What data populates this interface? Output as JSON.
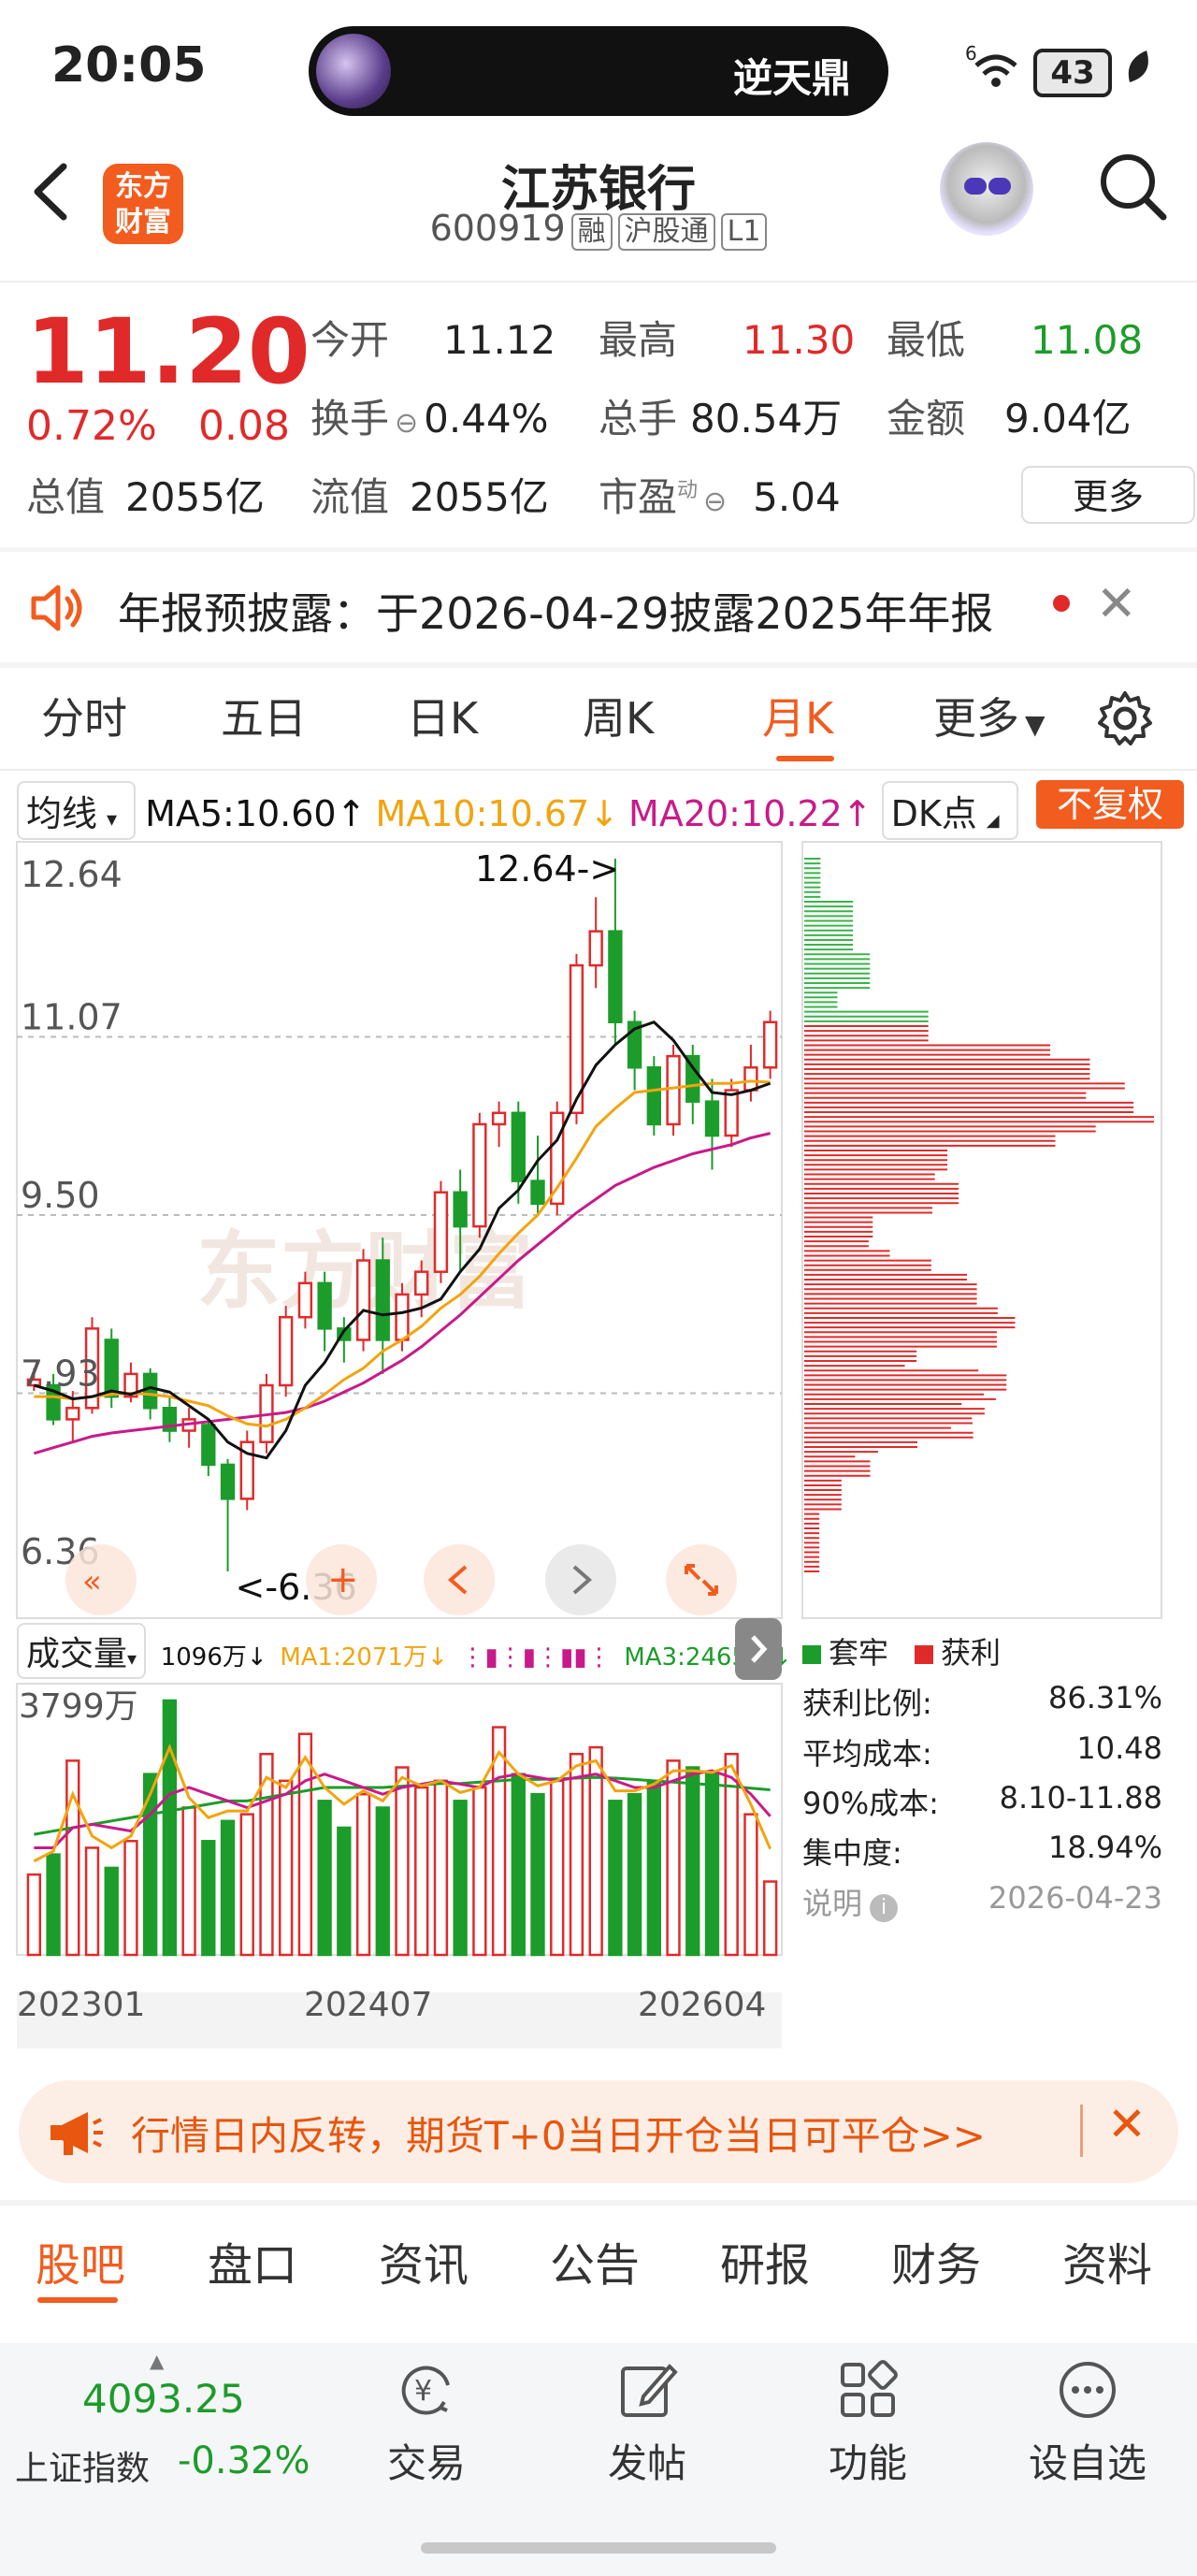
{
  "status_bar": {
    "time": "20:05",
    "island_title": "逆天鼎",
    "signal": "6",
    "battery": "43"
  },
  "header": {
    "logo_line1": "东方",
    "logo_line2": "财富",
    "name": "江苏银行",
    "code": "600919",
    "tags": [
      "融",
      "沪股通",
      "L1"
    ]
  },
  "quote": {
    "price": "11.20",
    "pct": "0.72%",
    "change": "0.08",
    "rows": [
      [
        {
          "label": "今开",
          "value": "11.12",
          "color": "#222"
        },
        {
          "label": "最高",
          "value": "11.30",
          "color": "#e02a2a"
        },
        {
          "label": "最低",
          "value": "11.08",
          "color": "#1c9c2a"
        }
      ],
      [
        {
          "label": "换手",
          "value": "0.44%",
          "color": "#222"
        },
        {
          "label": "总手",
          "value": "80.54万",
          "color": "#222"
        },
        {
          "label": "金额",
          "value": "9.04亿",
          "color": "#222"
        }
      ]
    ],
    "total_value_label": "总值",
    "total_value": "2055亿",
    "float_value_label": "流值",
    "float_value": "2055亿",
    "pe_label": "市盈",
    "pe_sup": "动",
    "pe_value": "5.04",
    "more_label": "更多"
  },
  "notice": {
    "text": "年报预披露：于2026-04-29披露2025年年报"
  },
  "period_tabs": [
    "分时",
    "五日",
    "日K",
    "周K",
    "月K",
    "更多"
  ],
  "active_tab": "月K",
  "ma_legend": {
    "selector": "均线",
    "ma5": "MA5:10.60↑",
    "ma10": "MA10:10.67↓",
    "ma20": "MA20:10.22↑",
    "dk": "DK点",
    "fuquan": "不复权"
  },
  "kline": {
    "price_labels": [
      "12.64",
      "11.07",
      "9.50",
      "7.93",
      "6.36"
    ],
    "high_marker": "12.64->",
    "low_marker": "<-6.36",
    "watermark": "东方财富",
    "colors": {
      "up": "#e02a2a",
      "down": "#1c9c2a",
      "ma5": "#111111",
      "ma10": "#f2a40f",
      "ma20": "#c81a8a"
    }
  },
  "chart_data": {
    "type": "candlestick",
    "period": "monthly",
    "ylim": [
      6.36,
      12.64
    ],
    "x_tick_labels": [
      "202301",
      "202407",
      "202604"
    ],
    "candles": [
      [
        8.0,
        8.05,
        7.95,
        8.15
      ],
      [
        8.0,
        7.7,
        7.65,
        8.1
      ],
      [
        7.7,
        7.8,
        7.5,
        7.95
      ],
      [
        7.8,
        8.5,
        7.75,
        8.6
      ],
      [
        8.4,
        7.9,
        7.8,
        8.5
      ],
      [
        7.9,
        8.1,
        7.85,
        8.2
      ],
      [
        8.1,
        7.8,
        7.7,
        8.15
      ],
      [
        7.8,
        7.6,
        7.5,
        7.9
      ],
      [
        7.6,
        7.7,
        7.45,
        7.8
      ],
      [
        7.65,
        7.3,
        7.2,
        7.7
      ],
      [
        7.3,
        7.0,
        6.36,
        7.35
      ],
      [
        7.0,
        7.5,
        6.9,
        7.6
      ],
      [
        7.5,
        8.0,
        7.4,
        8.1
      ],
      [
        8.0,
        8.6,
        7.9,
        8.7
      ],
      [
        8.6,
        8.9,
        8.5,
        9.0
      ],
      [
        8.9,
        8.5,
        8.3,
        9.0
      ],
      [
        8.5,
        8.4,
        8.2,
        8.6
      ],
      [
        8.4,
        9.1,
        8.3,
        9.2
      ],
      [
        9.1,
        8.4,
        8.1,
        9.3
      ],
      [
        8.4,
        8.8,
        8.3,
        8.9
      ],
      [
        8.8,
        9.0,
        8.6,
        9.1
      ],
      [
        9.0,
        9.7,
        8.9,
        9.8
      ],
      [
        9.7,
        9.4,
        9.0,
        9.9
      ],
      [
        9.4,
        10.3,
        9.3,
        10.4
      ],
      [
        10.3,
        10.4,
        10.1,
        10.5
      ],
      [
        10.4,
        9.8,
        9.6,
        10.5
      ],
      [
        9.8,
        9.6,
        9.5,
        10.2
      ],
      [
        9.6,
        10.4,
        9.5,
        10.5
      ],
      [
        10.4,
        11.7,
        10.3,
        11.8
      ],
      [
        11.7,
        12.0,
        11.5,
        12.3
      ],
      [
        12.0,
        11.2,
        11.0,
        12.64
      ],
      [
        11.2,
        10.8,
        10.6,
        11.3
      ],
      [
        10.8,
        10.3,
        10.2,
        10.9
      ],
      [
        10.3,
        10.9,
        10.2,
        11.0
      ],
      [
        10.9,
        10.5,
        10.3,
        11.0
      ],
      [
        10.5,
        10.2,
        9.9,
        10.7
      ],
      [
        10.2,
        10.6,
        10.1,
        10.7
      ],
      [
        10.6,
        10.8,
        10.5,
        11.0
      ],
      [
        10.8,
        11.2,
        10.7,
        11.3
      ]
    ],
    "ma5": [
      8.0,
      7.95,
      7.88,
      7.9,
      7.95,
      7.92,
      7.98,
      7.94,
      7.82,
      7.7,
      7.5,
      7.4,
      7.36,
      7.6,
      8.0,
      8.2,
      8.48,
      8.66,
      8.62,
      8.64,
      8.68,
      8.76,
      9.0,
      9.2,
      9.56,
      9.72,
      9.98,
      10.16,
      10.52,
      10.82,
      11.0,
      11.14,
      11.2,
      11.04,
      10.8,
      10.58,
      10.56,
      10.6,
      10.66
    ],
    "ma10": [
      7.9,
      7.9,
      7.88,
      7.9,
      7.92,
      7.93,
      7.92,
      7.9,
      7.86,
      7.82,
      7.73,
      7.66,
      7.64,
      7.7,
      7.8,
      7.92,
      8.05,
      8.15,
      8.3,
      8.4,
      8.52,
      8.68,
      8.8,
      8.96,
      9.16,
      9.34,
      9.5,
      9.74,
      10.0,
      10.28,
      10.44,
      10.58,
      10.6,
      10.62,
      10.64,
      10.66,
      10.66,
      10.68,
      10.67
    ],
    "ma20": [
      7.4,
      7.45,
      7.5,
      7.55,
      7.58,
      7.6,
      7.62,
      7.64,
      7.66,
      7.68,
      7.7,
      7.72,
      7.74,
      7.76,
      7.8,
      7.86,
      7.94,
      8.02,
      8.12,
      8.22,
      8.34,
      8.48,
      8.62,
      8.78,
      8.94,
      9.1,
      9.24,
      9.38,
      9.52,
      9.64,
      9.76,
      9.84,
      9.92,
      9.98,
      10.04,
      10.08,
      10.12,
      10.18,
      10.22
    ],
    "volume": {
      "ylabel_max": "3799万",
      "unit": "万",
      "values": [
        1200,
        1500,
        2900,
        1600,
        1300,
        1700,
        2700,
        3799,
        2200,
        1700,
        2000,
        2100,
        3000,
        2600,
        3300,
        2300,
        1900,
        2400,
        2200,
        2800,
        2500,
        2600,
        2300,
        2500,
        3400,
        2700,
        2400,
        2600,
        3000,
        3100,
        2300,
        2400,
        2600,
        2900,
        2800,
        2700,
        3000,
        2100,
        1096
      ],
      "ma1": [
        1600,
        1600,
        1900,
        1950,
        1900,
        1850,
        2100,
        2400,
        2500,
        2400,
        2300,
        2200,
        2300,
        2400,
        2600,
        2700,
        2600,
        2500,
        2400,
        2500,
        2550,
        2600,
        2550,
        2500,
        2650,
        2700,
        2650,
        2600,
        2650,
        2700,
        2600,
        2500,
        2500,
        2600,
        2700,
        2750,
        2650,
        2400,
        2071
      ],
      "ma3": [
        1800,
        1850,
        1900,
        1950,
        2000,
        2050,
        2100,
        2150,
        2200,
        2250,
        2300,
        2300,
        2350,
        2400,
        2450,
        2500,
        2500,
        2500,
        2500,
        2520,
        2540,
        2560,
        2560,
        2580,
        2600,
        2620,
        2620,
        2630,
        2640,
        2650,
        2640,
        2620,
        2600,
        2580,
        2560,
        2540,
        2520,
        2490,
        2465
      ]
    }
  },
  "volume_legend": {
    "selector": "成交量",
    "current": "1096万↓",
    "ma1": "MA1:2071万↓",
    "ma3": "MA3:2465万↓"
  },
  "chip": {
    "legend_trapped": "套牢",
    "legend_profit": "获利",
    "stats": [
      {
        "label": "获利比例:",
        "value": "86.31%"
      },
      {
        "label": "平均成本:",
        "value": "10.48"
      },
      {
        "label": "90%成本:",
        "value": "8.10-11.88"
      },
      {
        "label": "集中度:",
        "value": "18.94%"
      }
    ],
    "note_label": "说明",
    "note_date": "2026-04-23"
  },
  "ad": {
    "text": "行情日内反转，期货T+0当日开仓当日可平仓>>"
  },
  "bottom_tabs": [
    "股吧",
    "盘口",
    "资讯",
    "公告",
    "研报",
    "财务",
    "资料"
  ],
  "footer": {
    "index_value": "4093.25",
    "index_name": "上证指数",
    "index_pct": "-0.32%",
    "nav": [
      {
        "label": "交易",
        "icon": "yuan-exchange-icon"
      },
      {
        "label": "发帖",
        "icon": "edit-icon"
      },
      {
        "label": "功能",
        "icon": "apps-icon"
      },
      {
        "label": "设自选",
        "icon": "more-icon"
      }
    ]
  }
}
